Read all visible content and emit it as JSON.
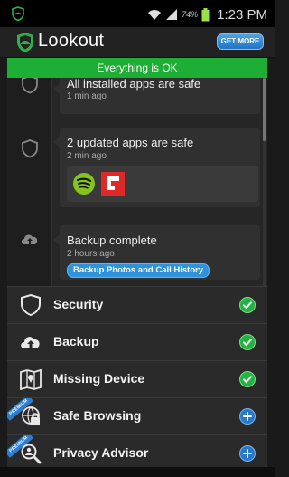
{
  "status_bar": {
    "battery": "74%",
    "time": "1:23 PM"
  },
  "app": {
    "title": "Lookout",
    "get_more": "GET MORE",
    "brand_color": "#1eae36"
  },
  "banner": {
    "text": "Everything is OK"
  },
  "timeline": {
    "items": [
      {
        "message": "All installed apps are safe",
        "time": "1 min ago"
      },
      {
        "message": "2 updated apps are safe",
        "time": "2 min ago",
        "app_icons": [
          "spotify-icon",
          "flipboard-icon"
        ]
      },
      {
        "message": "Backup complete",
        "time": "2 hours ago",
        "action": "Backup Photos and Call History"
      }
    ]
  },
  "menu": {
    "items": [
      {
        "label": "Security",
        "icon": "shield-icon",
        "status": "ok"
      },
      {
        "label": "Backup",
        "icon": "cloud-upload-icon",
        "status": "ok"
      },
      {
        "label": "Missing Device",
        "icon": "map-icon",
        "status": "ok"
      },
      {
        "label": "Safe Browsing",
        "icon": "lock-globe-icon",
        "status": "add",
        "ribbon": "PREMIUM"
      },
      {
        "label": "Privacy Advisor",
        "icon": "magnifier-person-icon",
        "status": "add",
        "ribbon": "PREMIUM"
      }
    ]
  }
}
